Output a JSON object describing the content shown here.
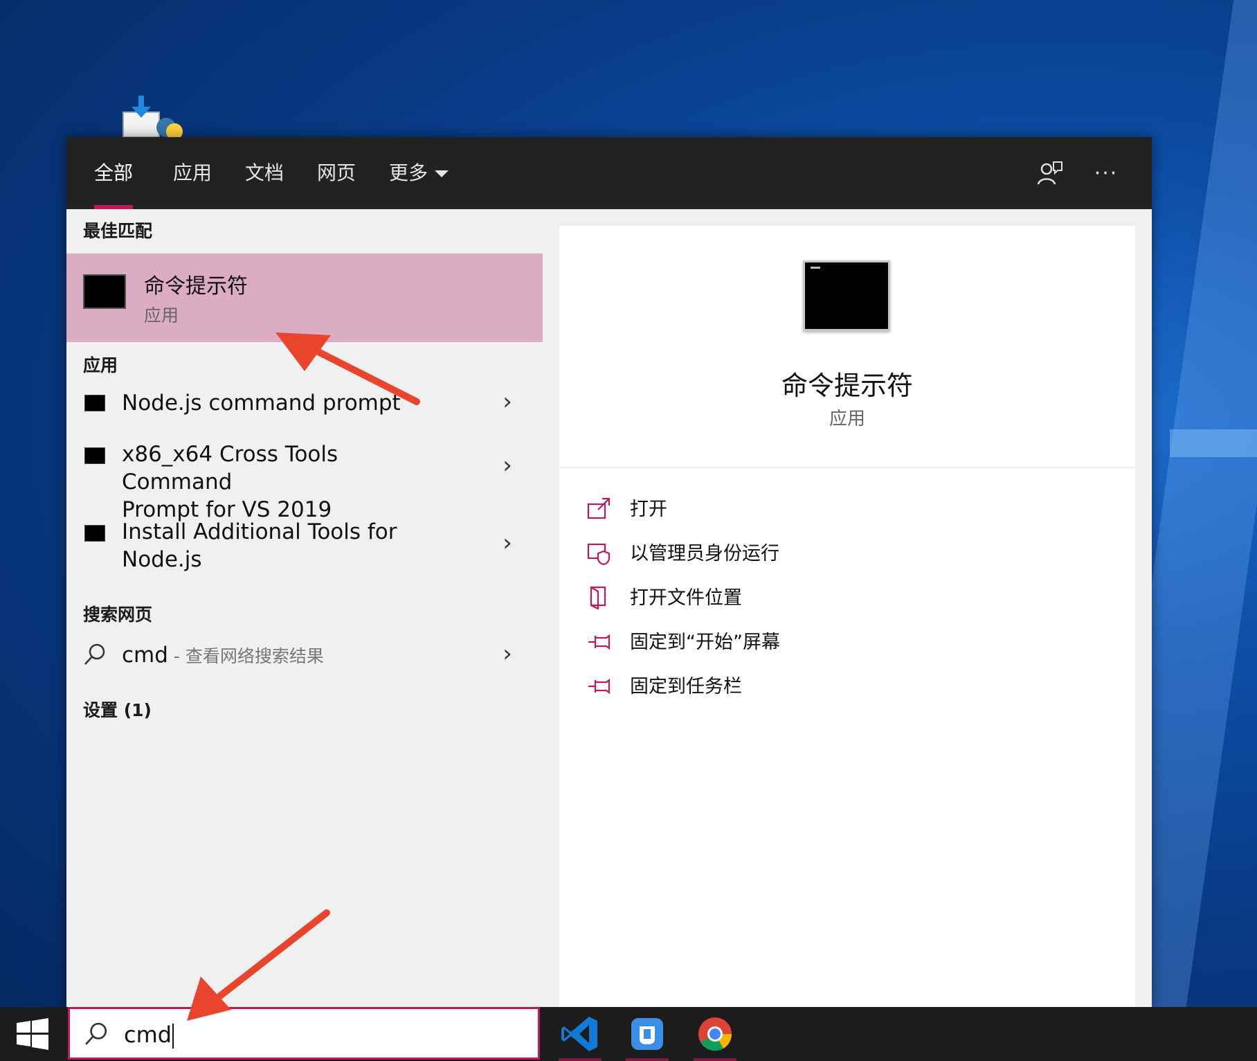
{
  "tabs": [
    {
      "label": "全部",
      "active": true
    },
    {
      "label": "应用"
    },
    {
      "label": "文档"
    },
    {
      "label": "网页"
    },
    {
      "label": "更多"
    }
  ],
  "best_match": {
    "section": "最佳匹配",
    "name": "命令提示符",
    "type": "应用"
  },
  "apps": {
    "section": "应用",
    "items": [
      {
        "line1": "Node.js command prompt",
        "line2": ""
      },
      {
        "line1": "x86_x64 Cross Tools Command",
        "line2": "Prompt for VS 2019"
      },
      {
        "line1": "Install Additional Tools for",
        "line2": "Node.js"
      }
    ]
  },
  "web": {
    "section": "搜索网页",
    "query": "cmd",
    "hint": " - 查看网络搜索结果"
  },
  "settings": {
    "section": "设置 (1)"
  },
  "detail": {
    "name": "命令提示符",
    "type": "应用",
    "actions": [
      {
        "label": "打开",
        "icon": "open-icon"
      },
      {
        "label": "以管理员身份运行",
        "icon": "admin-shield-icon"
      },
      {
        "label": "打开文件位置",
        "icon": "file-location-icon"
      },
      {
        "label": "固定到“开始”屏幕",
        "icon": "pin-icon"
      },
      {
        "label": "固定到任务栏",
        "icon": "pin-icon"
      }
    ]
  },
  "search": {
    "value": "cmd"
  },
  "colors": {
    "accent": "#c2185b",
    "selection": "#dcacc2",
    "topbar": "#222222"
  }
}
